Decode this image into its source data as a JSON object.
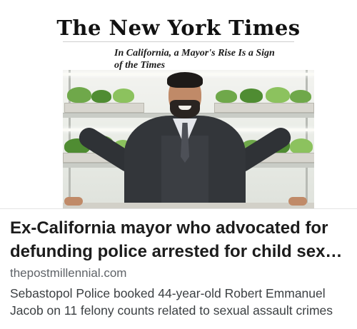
{
  "preview_image": {
    "masthead": "The New York Times",
    "nyt_headline": "In California, a Mayor's Rise Is a Sign of the Times"
  },
  "link_preview": {
    "title": "Ex-California mayor who advocated for defunding police arrested for child sex crimes",
    "domain": "thepostmillennial.com",
    "description": "Sebastopol Police booked 44-year-old Robert Emmanuel Jacob on 11 felony counts related to sexual assault crimes"
  },
  "colors": {
    "title_text": "#1c1c1c",
    "domain_text": "#5f6368",
    "description_text": "#3c4043",
    "background": "#ffffff"
  }
}
